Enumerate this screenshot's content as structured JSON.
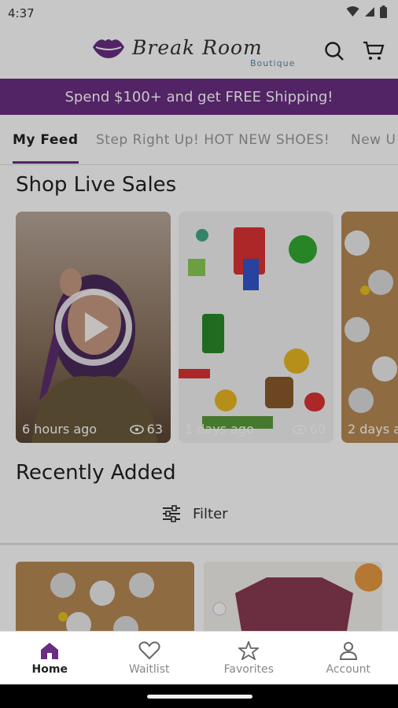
{
  "status_bar": {
    "time": "4:37"
  },
  "header": {
    "logo_text": "Break Room",
    "logo_subtext": "Boutique",
    "icons": [
      "search-icon",
      "cart-icon"
    ]
  },
  "banner": {
    "text": "Spend $100+ and get FREE Shipping!"
  },
  "tabs": [
    {
      "label": "My Feed",
      "active": true
    },
    {
      "label": "Step Right Up! HOT NEW SHOES!",
      "active": false
    },
    {
      "label": "New U",
      "active": false
    }
  ],
  "live_sales": {
    "title": "Shop Live Sales",
    "cards": [
      {
        "time": "6 hours ago",
        "views": "63"
      },
      {
        "time": "1 days ago",
        "views": "60"
      },
      {
        "time": "2 days a",
        "views": ""
      }
    ]
  },
  "recently_added": {
    "title": "Recently Added",
    "filter_label": "Filter"
  },
  "nav": [
    {
      "label": "Home",
      "icon": "home-icon",
      "active": true
    },
    {
      "label": "Waitlist",
      "icon": "heart-icon",
      "active": false
    },
    {
      "label": "Favorites",
      "icon": "star-icon",
      "active": false
    },
    {
      "label": "Account",
      "icon": "person-icon",
      "active": false
    }
  ],
  "colors": {
    "brand": "#6a2d82",
    "overlay": "rgba(0,0,0,0.22)"
  }
}
